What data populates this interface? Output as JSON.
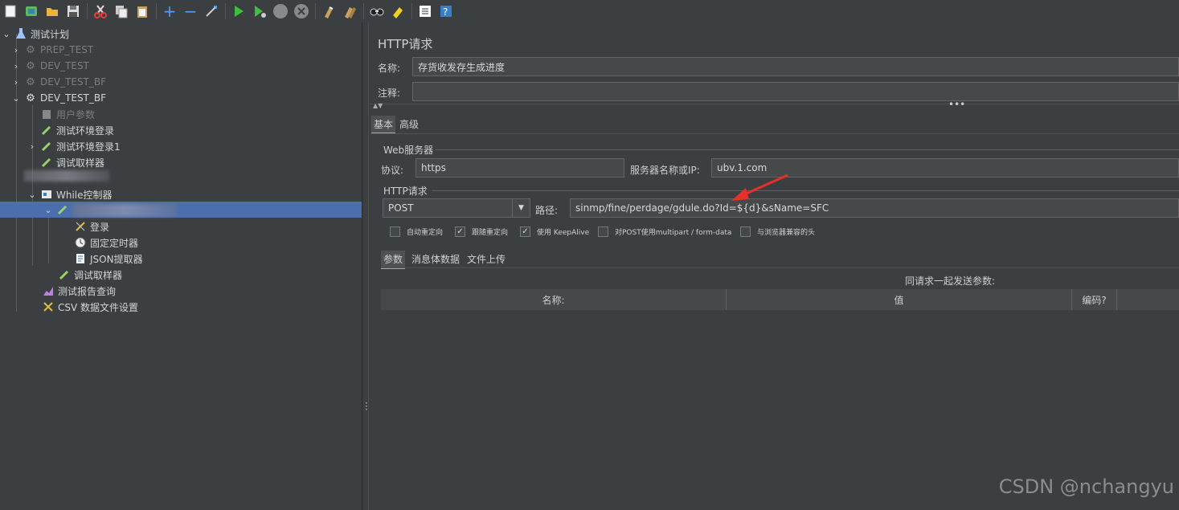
{
  "toolbar": {
    "icons": [
      "new-icon",
      "templates-icon",
      "open-icon",
      "save-icon",
      "cut-icon",
      "copy-icon",
      "paste-icon",
      "expand-icon",
      "collapse-icon",
      "toggle-icon",
      "start-icon",
      "start-no-pause-icon",
      "stop-icon",
      "shutdown-icon",
      "clear-icon",
      "clear-all-icon",
      "search-icon",
      "reset-search-icon",
      "function-helper-icon",
      "help-icon"
    ]
  },
  "tree": {
    "root": "测试计划",
    "groups": [
      "PREP_TEST",
      "DEV_TEST",
      "DEV_TEST_BF",
      "DEV_TEST_BF"
    ],
    "items": {
      "user_params": "用户参数",
      "login1": "测试环境登录",
      "login2": "测试环境登录1",
      "debug1": "调试取样器",
      "while": "While控制器",
      "login": "登录",
      "timer": "固定定时器",
      "json": "JSON提取器",
      "debug2": "调试取样器",
      "report": "测试报告查询",
      "csv": "CSV 数据文件设置"
    }
  },
  "panel": {
    "title": "HTTP请求",
    "name_label": "名称:",
    "name_value": "存货收发存生成进度",
    "comment_label": "注释:",
    "comment_value": "",
    "tabs": [
      "基本",
      "高级"
    ],
    "web_server_section": "Web服务器",
    "protocol_label": "协议:",
    "protocol_value": "https",
    "server_label": "服务器名称或IP:",
    "server_value": "ubv.1.com",
    "http_section": "HTTP请求",
    "method_value": "POST",
    "path_label": "路径:",
    "path_value": "sinmp/fine/perdage/gdule.do?Id=${d}&sName=SFC",
    "checkboxes": [
      {
        "label": "自动重定向",
        "checked": false
      },
      {
        "label": "跟随重定向",
        "checked": true
      },
      {
        "label": "使用 KeepAlive",
        "checked": true
      },
      {
        "label": "对POST使用multipart / form-data",
        "checked": false
      },
      {
        "label": "与浏览器兼容的头",
        "checked": false
      }
    ],
    "subtabs": [
      "参数",
      "消息体数据",
      "文件上传"
    ],
    "params_caption": "同请求一起发送参数:",
    "table_headers": [
      "名称:",
      "值",
      "编码?"
    ]
  },
  "watermark": "CSDN @nchangyu",
  "colors": {
    "selection": "#4b6eaf",
    "arrow": "#e8302a"
  }
}
